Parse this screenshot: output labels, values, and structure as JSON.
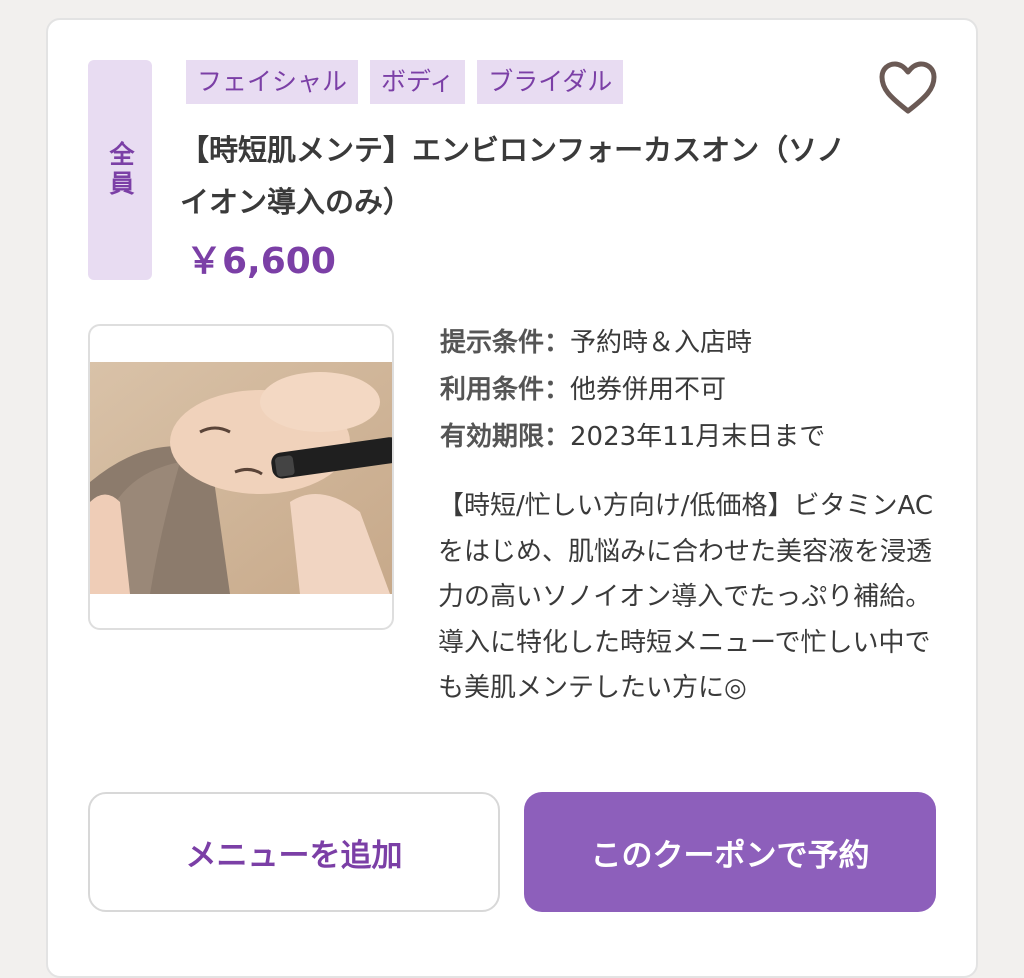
{
  "coupon": {
    "target": "全員",
    "tags": [
      "フェイシャル",
      "ボディ",
      "ブライダル"
    ],
    "title": "【時短肌メンテ】エンビロンフォーカスオン（ソノイオン導入のみ）",
    "price": "￥6,600",
    "favorite_icon": "heart-outline-icon",
    "conditions": [
      {
        "label": "提示条件：",
        "value": "予約時＆入店時"
      },
      {
        "label": "利用条件：",
        "value": "他券併用不可"
      },
      {
        "label": "有効期限：",
        "value": "2023年11月末日まで"
      }
    ],
    "description": "【時短/忙しい方向け/低価格】ビタミンACをはじめ、肌悩みに合わせた美容液を浸透力の高いソノイオン導入でたっぷり補給。導入に特化した時短メニューで忙しい中でも美肌メンテしたい方に◎"
  },
  "actions": {
    "add_menu_label": "メニューを追加",
    "reserve_label": "このクーポンで予約"
  },
  "colors": {
    "accent": "#7b3fa6",
    "badge_bg": "#e8dcf2",
    "button_bg": "#8d5fbb"
  }
}
